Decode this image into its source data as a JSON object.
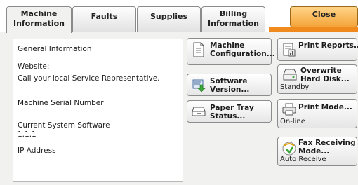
{
  "tabs": [
    {
      "line1": "Machine",
      "line2": "Information"
    },
    {
      "line1": "Faults",
      "line2": ""
    },
    {
      "line1": "Supplies",
      "line2": ""
    },
    {
      "line1": "Billing",
      "line2": "Information"
    }
  ],
  "close_label": "Close",
  "info": {
    "general_info": "General Information",
    "website_label": "Website:",
    "website_value": "Call your local Service Representative.",
    "serial_label": "Machine Serial Number",
    "software_label": "Current System Software",
    "software_value": "1.1.1",
    "ip_label": "IP Address"
  },
  "buttons": {
    "machine_config": {
      "line1": "Machine",
      "line2": "Configuration..."
    },
    "software_version": {
      "line1": "Software",
      "line2": "Version..."
    },
    "paper_tray": {
      "line1": "Paper Tray",
      "line2": "Status..."
    },
    "print_reports": {
      "line1": "Print Reports..."
    },
    "overwrite": {
      "line1": "Overwrite",
      "line2": "Hard Disk...",
      "status": "Standby"
    },
    "print_mode": {
      "line1": "Print Mode...",
      "status": "On-line"
    },
    "fax_receiving": {
      "line1": "Fax Receiving",
      "line2": "Mode...",
      "status": "Auto Receive"
    }
  },
  "icons": {
    "machine_config": "document-icon",
    "software_version": "software-update-icon",
    "paper_tray": "paper-tray-icon",
    "print_reports": "report-icon",
    "overwrite": "hard-disk-icon",
    "print_mode": "printer-icon",
    "fax_receiving": "fax-receive-icon"
  },
  "colors": {
    "accent": "#f08a1c",
    "close_button": "#f4a43a",
    "panel": "#f1f1ef"
  }
}
